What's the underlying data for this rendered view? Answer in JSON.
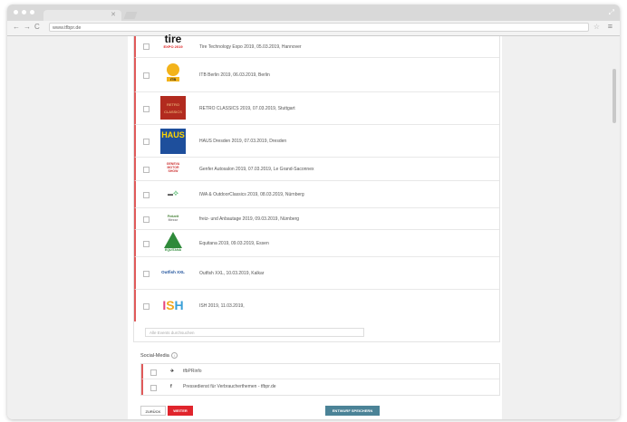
{
  "browser": {
    "url": "www.tfbpr.de",
    "nav_back": "←",
    "nav_forward": "→",
    "nav_reload": "C",
    "star_icon": "☆",
    "menu_icon": "≡",
    "tab_close": "✕",
    "window_controls": "⤢"
  },
  "events": [
    {
      "logo": "tire",
      "label": "Tire Technology Expo 2019, 05.03.2019, Hannover"
    },
    {
      "logo": "ITB",
      "label": "ITB Berlin 2019, 06.03.2019, Berlin"
    },
    {
      "logo": "RETRO CLASSICS",
      "label": "RETRO CLASSICS 2019, 07.03.2019, Stuttgart"
    },
    {
      "logo": "HAUS",
      "label": "HAUS Dresden 2019, 07.03.2019, Dresden"
    },
    {
      "logo": "GENEVA MOTOR SHOW",
      "label": "Genfer Autosalon 2019, 07.03.2019, Le Grand-Saconnex"
    },
    {
      "logo": "IWA",
      "label": "IWA & OutdoorClassics 2019, 08.03.2019, Nürnberg"
    },
    {
      "logo": "Freizeit Messe",
      "label": "freiz- und Anbautage 2019, 09.03.2019, Nürnberg"
    },
    {
      "logo": "EQUITANA",
      "label": "Equitana 2019, 09.03.2019, Essen"
    },
    {
      "logo": "Outfish XXL",
      "label": "Outfish XXL, 10.03.2019, Kalkar"
    },
    {
      "logo": "ISH",
      "label": "ISH 2019, 11.03.2019,"
    }
  ],
  "filter_placeholder": "Alle Events durchsuchen",
  "social": {
    "heading": "Social-Media",
    "info": "i",
    "items": [
      {
        "icon": "twitter-icon",
        "glyph": "✈",
        "label": "tfbPRinfo"
      },
      {
        "icon": "facebook-icon",
        "glyph": "f",
        "label": "Pressedienst für Verbraucherthemen - tfbpr.de"
      }
    ]
  },
  "buttons": {
    "back": "ZURÜCK",
    "next": "WEITER",
    "save": "ENTWURF SPEICHERN"
  },
  "colors": {
    "accent_red": "#e0242c",
    "save_blue": "#4b8397",
    "row_marker": "#e05a5a"
  }
}
